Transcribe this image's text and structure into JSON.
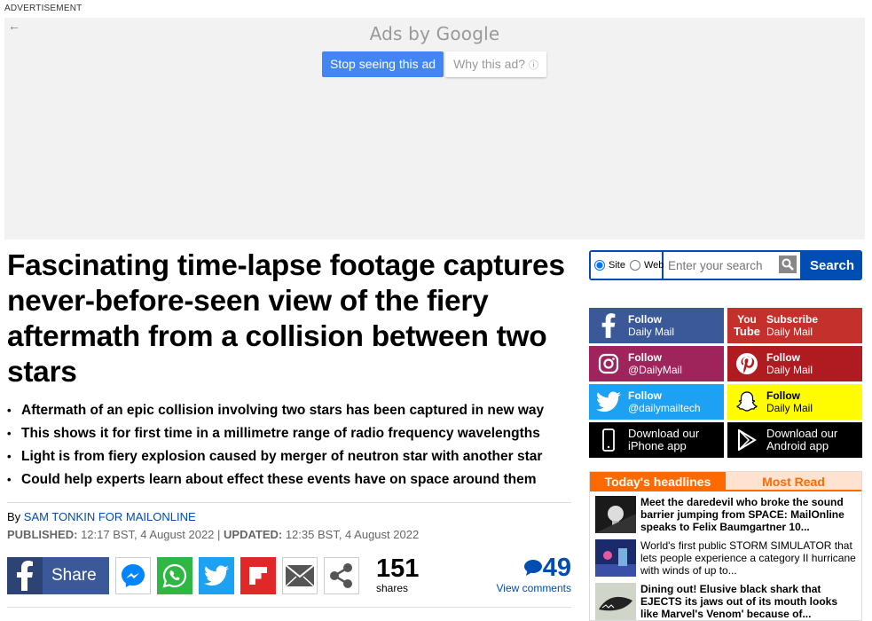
{
  "ad": {
    "label": "ADVERTISEMENT",
    "back_glyph": "←",
    "brand": "Ads by Google",
    "stop_label": "Stop seeing this ad",
    "why_label": "Why this ad?",
    "info_glyph": "ⓘ"
  },
  "article": {
    "headline": "Fascinating time-lapse footage captures never-before-seen view of the fiery aftermath from a collision between two stars",
    "bullets": [
      "Aftermath of an epic collision involving two stars has been captured in new way",
      "This shows it for first time in a millimetre range of radio frequency wavelengths",
      "Light is from fiery explosion caused by merger of neutron star with another star",
      "Could help experts learn about effect these events have on space around them"
    ],
    "byline_prefix": "By ",
    "author": "SAM TONKIN FOR MAILONLINE",
    "published_label": "PUBLISHED:",
    "published_value": " 12:17 BST, 4 August 2022 | ",
    "updated_label": "UPDATED:",
    "updated_value": " 12:35 BST, 4 August 2022"
  },
  "share": {
    "facebook_label": "Share",
    "count": "151",
    "count_label": "shares",
    "comments_count": "49",
    "comments_label": "View comments",
    "icons": [
      "facebook-icon",
      "messenger-icon",
      "whatsapp-icon",
      "twitter-icon",
      "flipboard-icon",
      "email-icon",
      "share-icon"
    ]
  },
  "search": {
    "site_label": "Site",
    "web_label": "Web",
    "placeholder": "Enter your search",
    "button_label": "Search",
    "selected": "Site"
  },
  "follow": [
    {
      "line1": "Follow",
      "line2": "Daily Mail",
      "icon": "facebook-icon",
      "color": "#3b5998"
    },
    {
      "line1": "Subscribe",
      "line2": "Daily Mail",
      "icon": "youtube-icon",
      "color": "#c4302b"
    },
    {
      "line1": "Follow",
      "line2": "@DailyMail",
      "icon": "instagram-icon",
      "color": "#a0245c"
    },
    {
      "line1": "Follow",
      "line2": "Daily Mail",
      "icon": "pinterest-icon",
      "color": "#b01b22"
    },
    {
      "line1": "Follow",
      "line2": "@dailymailtech",
      "icon": "twitter-icon",
      "color": "#1da1f2"
    },
    {
      "line1": "Follow",
      "line2": "Daily Mail",
      "icon": "snapchat-icon",
      "color": "#fffc00"
    },
    {
      "line1": "Download our",
      "line2": "iPhone app",
      "icon": "iphone-icon",
      "color": "#000000"
    },
    {
      "line1": "Download our",
      "line2": "Android app",
      "icon": "android-play-icon",
      "color": "#000000"
    }
  ],
  "youtube_logo": {
    "top": "You",
    "bottom": "Tube"
  },
  "headlines": {
    "tab_active": "Today's headlines",
    "tab_inactive": "Most Read",
    "items": [
      {
        "text": "Meet the daredevil who broke the sound barrier jumping from SPACE: MailOnline speaks to Felix Baumgartner 10...",
        "bold": true
      },
      {
        "text": "World's first public STORM SIMULATOR that lets people experience a category II hurricane with winds of up to...",
        "bold": false
      },
      {
        "text": "Dining out! Elusive black shark that EJECTS its jaws out of its mouth looks like Marvel's Venom' because of...",
        "bold": true
      }
    ]
  },
  "colors": {
    "accent_blue": "#004db3",
    "orange": "#ff6a00",
    "google_blue": "#4285f4"
  }
}
